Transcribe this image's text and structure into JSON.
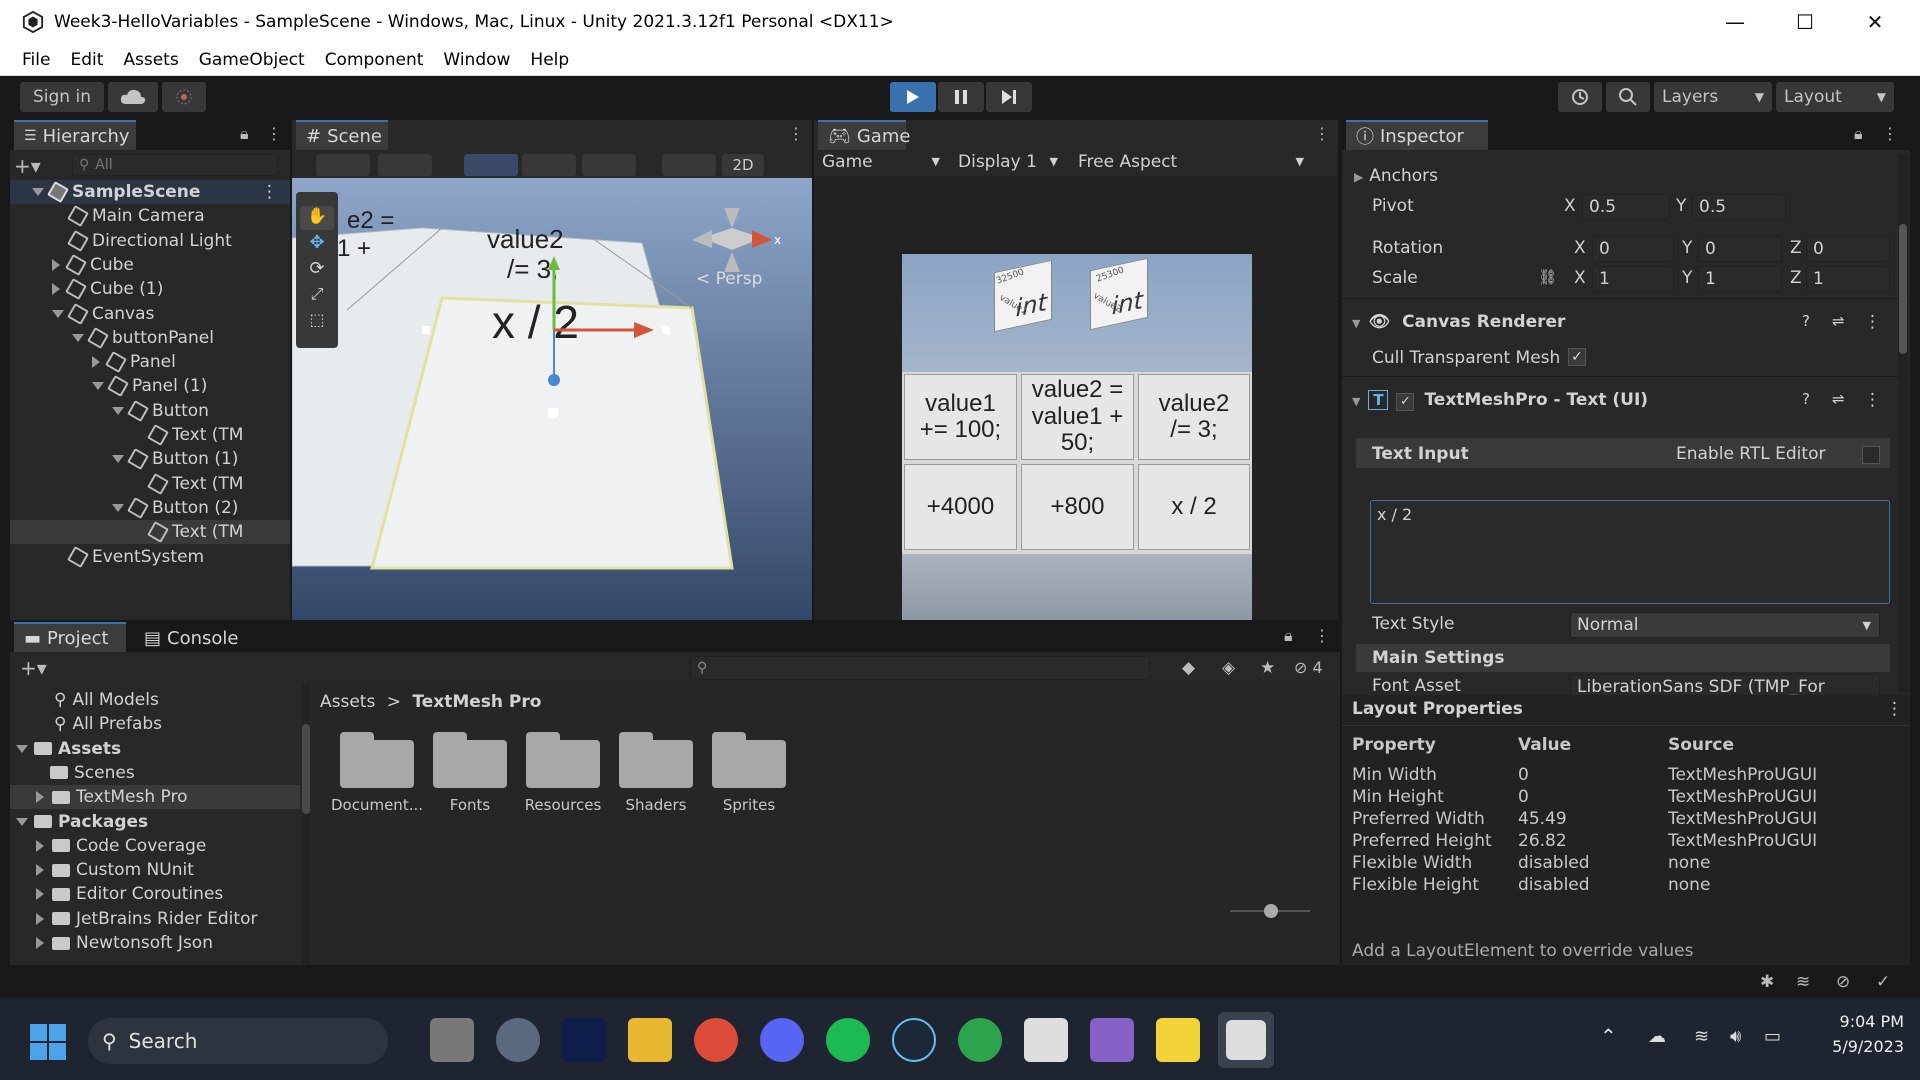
{
  "window": {
    "title": "Week3-HelloVariables - SampleScene - Windows, Mac, Linux - Unity 2021.3.12f1 Personal <DX11>",
    "minimize": "—",
    "maximize": "☐",
    "close": "✕"
  },
  "menu": [
    "File",
    "Edit",
    "Assets",
    "GameObject",
    "Component",
    "Window",
    "Help"
  ],
  "toolbar": {
    "sign_in": "Sign in",
    "layers": "Layers",
    "layout": "Layout"
  },
  "hierarchy": {
    "tab": "Hierarchy",
    "search_placeholder": "All",
    "rows": [
      {
        "label": "SampleScene",
        "indent": 0,
        "scene": true
      },
      {
        "label": "Main Camera",
        "indent": 1
      },
      {
        "label": "Directional Light",
        "indent": 1
      },
      {
        "label": "Cube",
        "indent": 1
      },
      {
        "label": "Cube (1)",
        "indent": 1
      },
      {
        "label": "Canvas",
        "indent": 1
      },
      {
        "label": "buttonPanel",
        "indent": 2
      },
      {
        "label": "Panel",
        "indent": 3
      },
      {
        "label": "Panel (1)",
        "indent": 3
      },
      {
        "label": "Button",
        "indent": 4
      },
      {
        "label": "Text (TM",
        "indent": 5
      },
      {
        "label": "Button (1)",
        "indent": 4
      },
      {
        "label": "Text (TM",
        "indent": 5
      },
      {
        "label": "Button (2)",
        "indent": 4
      },
      {
        "label": "Text (TM",
        "indent": 5
      },
      {
        "label": "EventSystem",
        "indent": 1
      }
    ]
  },
  "scene": {
    "tab": "Scene",
    "mode_2d": "2D",
    "persp": "< Persp",
    "text_main": "x / 2",
    "text_value2": "value2\n/= 3;",
    "text_partial1": "e2 =",
    "text_partial2": "1 +"
  },
  "game": {
    "tab": "Game",
    "dropdown_game": "Game",
    "display": "Display 1",
    "aspect": "Free Aspect",
    "cube1_a": "int",
    "cube1_b": "32500",
    "cube1_c": "value1",
    "cube2_a": "int",
    "cube2_b": "25300",
    "cube2_c": "value2",
    "buttons": [
      "value1\n+= 100;",
      "value2 =\nvalue1 +\n50;",
      "value2\n/= 3;",
      "+4000",
      "+800",
      "x / 2"
    ]
  },
  "inspector": {
    "tab": "Inspector",
    "anchors": "Anchors",
    "pivot_label": "Pivot",
    "pivot": {
      "x": "0.5",
      "y": "0.5"
    },
    "rotation_label": "Rotation",
    "rotation": {
      "x": "0",
      "y": "0",
      "z": "0"
    },
    "scale_label": "Scale",
    "scale": {
      "x": "1",
      "y": "1",
      "z": "1"
    },
    "axis": {
      "x": "X",
      "y": "Y",
      "z": "Z"
    },
    "canvas_renderer": "Canvas Renderer",
    "cull_label": "Cull Transparent Mesh",
    "tmp_title": "TextMeshPro - Text (UI)",
    "text_input": "Text Input",
    "rtl": "Enable RTL Editor",
    "text_value": "x / 2",
    "text_style_label": "Text Style",
    "text_style": "Normal",
    "main_settings": "Main Settings",
    "font_asset_label": "Font Asset",
    "font_asset": "LiberationSans SDF (TMP_For"
  },
  "layout_props": {
    "title": "Layout Properties",
    "headers": [
      "Property",
      "Value",
      "Source"
    ],
    "rows": [
      [
        "Min Width",
        "0",
        "TextMeshProUGUI"
      ],
      [
        "Min Height",
        "0",
        "TextMeshProUGUI"
      ],
      [
        "Preferred Width",
        "45.49",
        "TextMeshProUGUI"
      ],
      [
        "Preferred Height",
        "26.82",
        "TextMeshProUGUI"
      ],
      [
        "Flexible Width",
        "disabled",
        "none"
      ],
      [
        "Flexible Height",
        "disabled",
        "none"
      ]
    ],
    "footer": "Add a LayoutElement to override values"
  },
  "project": {
    "tab_project": "Project",
    "tab_console": "Console",
    "hidden_count": "4",
    "tree": [
      {
        "label": "All Models",
        "indent": 1,
        "type": "search"
      },
      {
        "label": "All Prefabs",
        "indent": 1,
        "type": "search"
      },
      {
        "label": "Assets",
        "indent": 0,
        "type": "open"
      },
      {
        "label": "Scenes",
        "indent": 1,
        "type": "folder"
      },
      {
        "label": "TextMesh Pro",
        "indent": 1,
        "type": "closed"
      },
      {
        "label": "Packages",
        "indent": 0,
        "type": "open"
      },
      {
        "label": "Code Coverage",
        "indent": 1,
        "type": "closed"
      },
      {
        "label": "Custom NUnit",
        "indent": 1,
        "type": "closed"
      },
      {
        "label": "Editor Coroutines",
        "indent": 1,
        "type": "closed"
      },
      {
        "label": "JetBrains Rider Editor",
        "indent": 1,
        "type": "closed"
      },
      {
        "label": "Newtonsoft Json",
        "indent": 1,
        "type": "closed"
      }
    ],
    "breadcrumb_root": "Assets",
    "breadcrumb_sep": ">",
    "breadcrumb_current": "TextMesh Pro",
    "folders": [
      "Document...",
      "Fonts",
      "Resources",
      "Shaders",
      "Sprites"
    ]
  },
  "taskbar": {
    "search": "Search",
    "time": "9:04 PM",
    "date": "5/9/2023"
  }
}
